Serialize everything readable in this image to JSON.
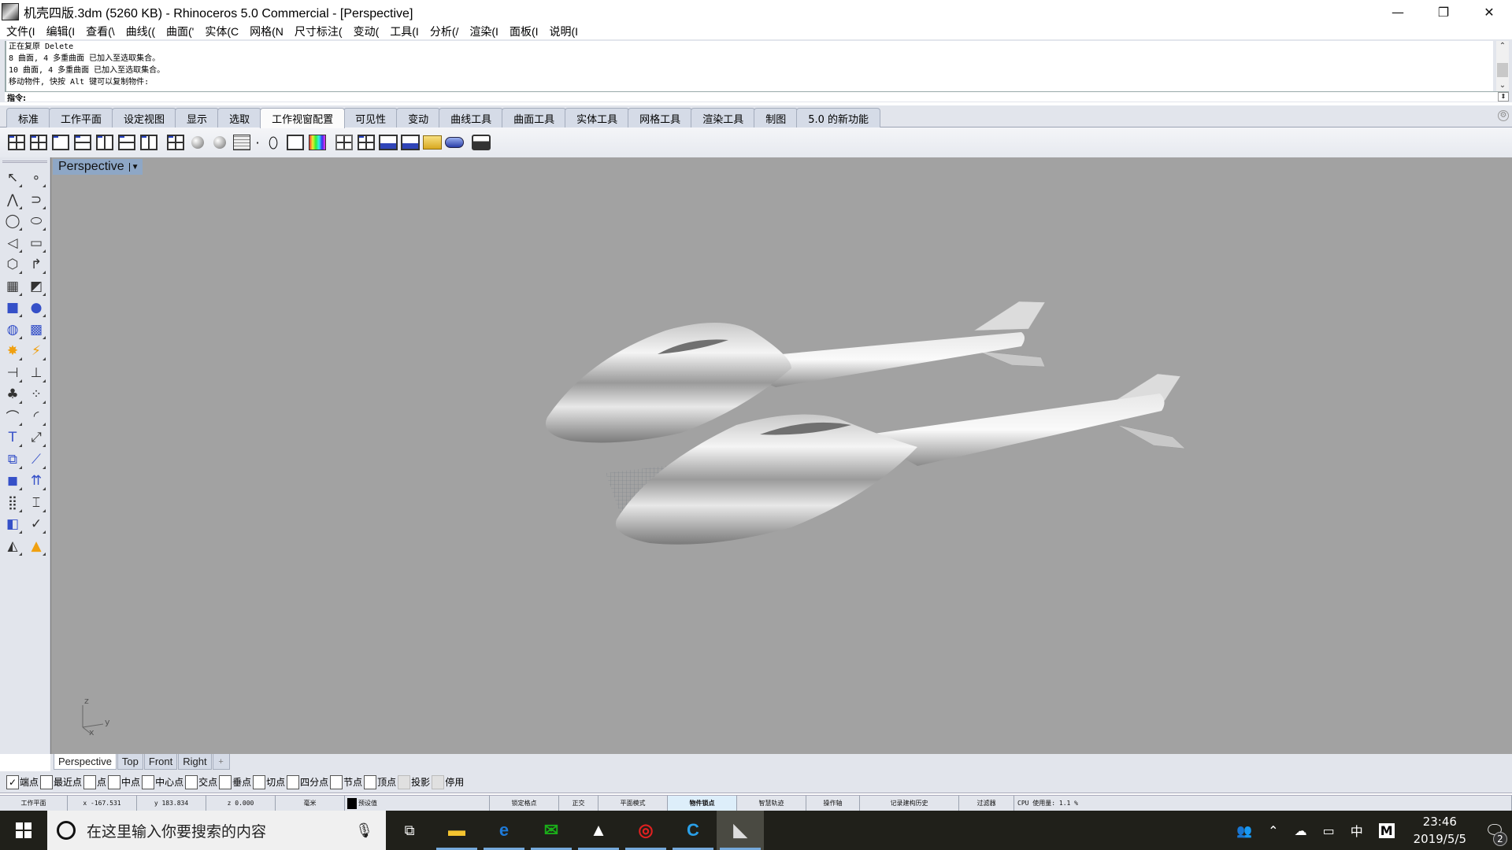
{
  "window": {
    "title": "机壳四版.3dm (5260 KB) - Rhinoceros 5.0 Commercial - [Perspective]",
    "controls": {
      "minimize": "—",
      "restore": "❐",
      "close": "✕"
    }
  },
  "menu": [
    "文件(I",
    "编辑(I",
    "查看(\\",
    "曲线((",
    "曲面('",
    "实体(C",
    "网格(N",
    "尺寸标注(",
    "变动(",
    "工具(I",
    "分析(/",
    "渲染(I",
    "面板(I",
    "说明(I"
  ],
  "command": {
    "history": [
      "正在复原 Delete",
      "8 曲面, 4 多重曲面 已加入至选取集合。",
      "10 曲面, 4 多重曲面 已加入至选取集合。",
      "移动物件, 快按 Alt 键可以复制物件:"
    ],
    "prompt_label": "指令:",
    "value": ""
  },
  "toolbar_tabs": {
    "active_index": 5,
    "items": [
      "标准",
      "工作平面",
      "设定视图",
      "显示",
      "选取",
      "工作视窗配置",
      "可见性",
      "变动",
      "曲线工具",
      "曲面工具",
      "实体工具",
      "网格工具",
      "渲染工具",
      "制图",
      "5.0 的新功能"
    ]
  },
  "icon_toolbar": [
    "viewport-layout-3-icon",
    "viewport-layout-4-icon",
    "single-viewport-icon",
    "viewport-center-icon",
    "viewport-properties-icon",
    "split-horizontal-icon",
    "split-vertical-icon",
    "viewport-tiles-icon",
    "sphere-view-icon",
    "two-spheres-icon",
    "grid-icon",
    "point-icon",
    "ellipse-icon",
    "portrait-icon",
    "color-palette-icon",
    "new-layout-icon",
    "four-viewports-icon",
    "viewport-width-icon",
    "water-plane-icon",
    "open-folder-icon",
    "camera-icon",
    "print-icon"
  ],
  "toolbox": [
    {
      "name": "select-icon",
      "glyph": "↖"
    },
    {
      "name": "point-icon",
      "glyph": "∘"
    },
    {
      "name": "polyline-icon",
      "glyph": "⋀"
    },
    {
      "name": "curve-icon",
      "glyph": "⊃"
    },
    {
      "name": "circle-icon",
      "glyph": "◯"
    },
    {
      "name": "ellipse-icon",
      "glyph": "⬭"
    },
    {
      "name": "arc-icon",
      "glyph": "◁"
    },
    {
      "name": "rectangle-icon",
      "glyph": "▭"
    },
    {
      "name": "polygon-icon",
      "glyph": "⬡"
    },
    {
      "name": "fillet-curve-icon",
      "glyph": "↱"
    },
    {
      "name": "surface-points-icon",
      "glyph": "▦"
    },
    {
      "name": "extrude-surface-icon",
      "glyph": "◩"
    },
    {
      "name": "box-icon",
      "glyph": "■"
    },
    {
      "name": "boolean-spheres-icon",
      "glyph": "●"
    },
    {
      "name": "cylinder-icon",
      "glyph": "◍"
    },
    {
      "name": "mesh-surface-icon",
      "glyph": "▩"
    },
    {
      "name": "explode-icon",
      "glyph": "✸"
    },
    {
      "name": "trim-icon",
      "glyph": "⚡"
    },
    {
      "name": "split-icon",
      "glyph": "⊣"
    },
    {
      "name": "join-icon",
      "glyph": "⊥"
    },
    {
      "name": "render-material-icon",
      "glyph": "♣"
    },
    {
      "name": "color-dots-icon",
      "glyph": "⁘"
    },
    {
      "name": "fillet-icon",
      "glyph": "⌒"
    },
    {
      "name": "offset-curve-icon",
      "glyph": "◜"
    },
    {
      "name": "text-icon",
      "glyph": "T"
    },
    {
      "name": "scale-icon",
      "glyph": "⤢"
    },
    {
      "name": "group-icon",
      "glyph": "⧉"
    },
    {
      "name": "rotate-icon",
      "glyph": "⟋"
    },
    {
      "name": "solid-edit-icon",
      "glyph": "◼"
    },
    {
      "name": "project-icon",
      "glyph": "⇈"
    },
    {
      "name": "array-icon",
      "glyph": "⣿"
    },
    {
      "name": "dimension-icon",
      "glyph": "⌶"
    },
    {
      "name": "analyze-icon",
      "glyph": "◧"
    },
    {
      "name": "check-icon",
      "glyph": "✓"
    },
    {
      "name": "shade-icon",
      "glyph": "◭"
    },
    {
      "name": "render-icon",
      "glyph": "▲"
    }
  ],
  "viewport": {
    "title": "Perspective",
    "axes": {
      "x": "x",
      "y": "y",
      "z": "z"
    },
    "tabs": [
      "Perspective",
      "Top",
      "Front",
      "Right"
    ],
    "active_tab": "Perspective",
    "add_tab": "+"
  },
  "osnap": [
    {
      "label": "端点",
      "checked": true,
      "enabled": true
    },
    {
      "label": "最近点",
      "checked": false,
      "enabled": true
    },
    {
      "label": "点",
      "checked": false,
      "enabled": true
    },
    {
      "label": "中点",
      "checked": false,
      "enabled": true
    },
    {
      "label": "中心点",
      "checked": false,
      "enabled": true
    },
    {
      "label": "交点",
      "checked": false,
      "enabled": true
    },
    {
      "label": "垂点",
      "checked": false,
      "enabled": true
    },
    {
      "label": "切点",
      "checked": false,
      "enabled": true
    },
    {
      "label": "四分点",
      "checked": false,
      "enabled": true
    },
    {
      "label": "节点",
      "checked": false,
      "enabled": true
    },
    {
      "label": "顶点",
      "checked": false,
      "enabled": true
    },
    {
      "label": "投影",
      "checked": false,
      "enabled": false
    },
    {
      "label": "停用",
      "checked": false,
      "enabled": false
    }
  ],
  "status": {
    "cplane": "工作平面",
    "x": "x -167.531",
    "y": "y 183.834",
    "z": "z 0.000",
    "units": "毫米",
    "layer": "预设值",
    "layer_color": "#000000",
    "grid_snap": "锁定格点",
    "ortho": "正交",
    "planar": "平面模式",
    "osnap": "物件锁点",
    "smarttrack": "智慧轨迹",
    "gumball": "操作轴",
    "history": "记录建构历史",
    "filter": "过滤器",
    "cpu": "CPU 使用量: 1.1 %"
  },
  "taskbar": {
    "search_placeholder": "在这里输入你要搜索的内容",
    "apps": [
      {
        "name": "file-explorer",
        "glyph": "▬",
        "color": "#f4c430",
        "running": true
      },
      {
        "name": "edge",
        "glyph": "e",
        "color": "#1e7ad8",
        "running": true
      },
      {
        "name": "wechat",
        "glyph": "✉",
        "color": "#1aad19",
        "running": true
      },
      {
        "name": "photos",
        "glyph": "▲",
        "color": "#ffffff",
        "running": true
      },
      {
        "name": "netease-music",
        "glyph": "◎",
        "color": "#e02020",
        "running": true
      },
      {
        "name": "c-app",
        "glyph": "C",
        "color": "#2aa0e8",
        "running": true
      },
      {
        "name": "rhino",
        "glyph": "◣",
        "color": "#dddddd",
        "running": true
      }
    ],
    "ime": "中",
    "ime_mode": "M",
    "time": "23:46",
    "date": "2019/5/5",
    "notifications": "2"
  }
}
